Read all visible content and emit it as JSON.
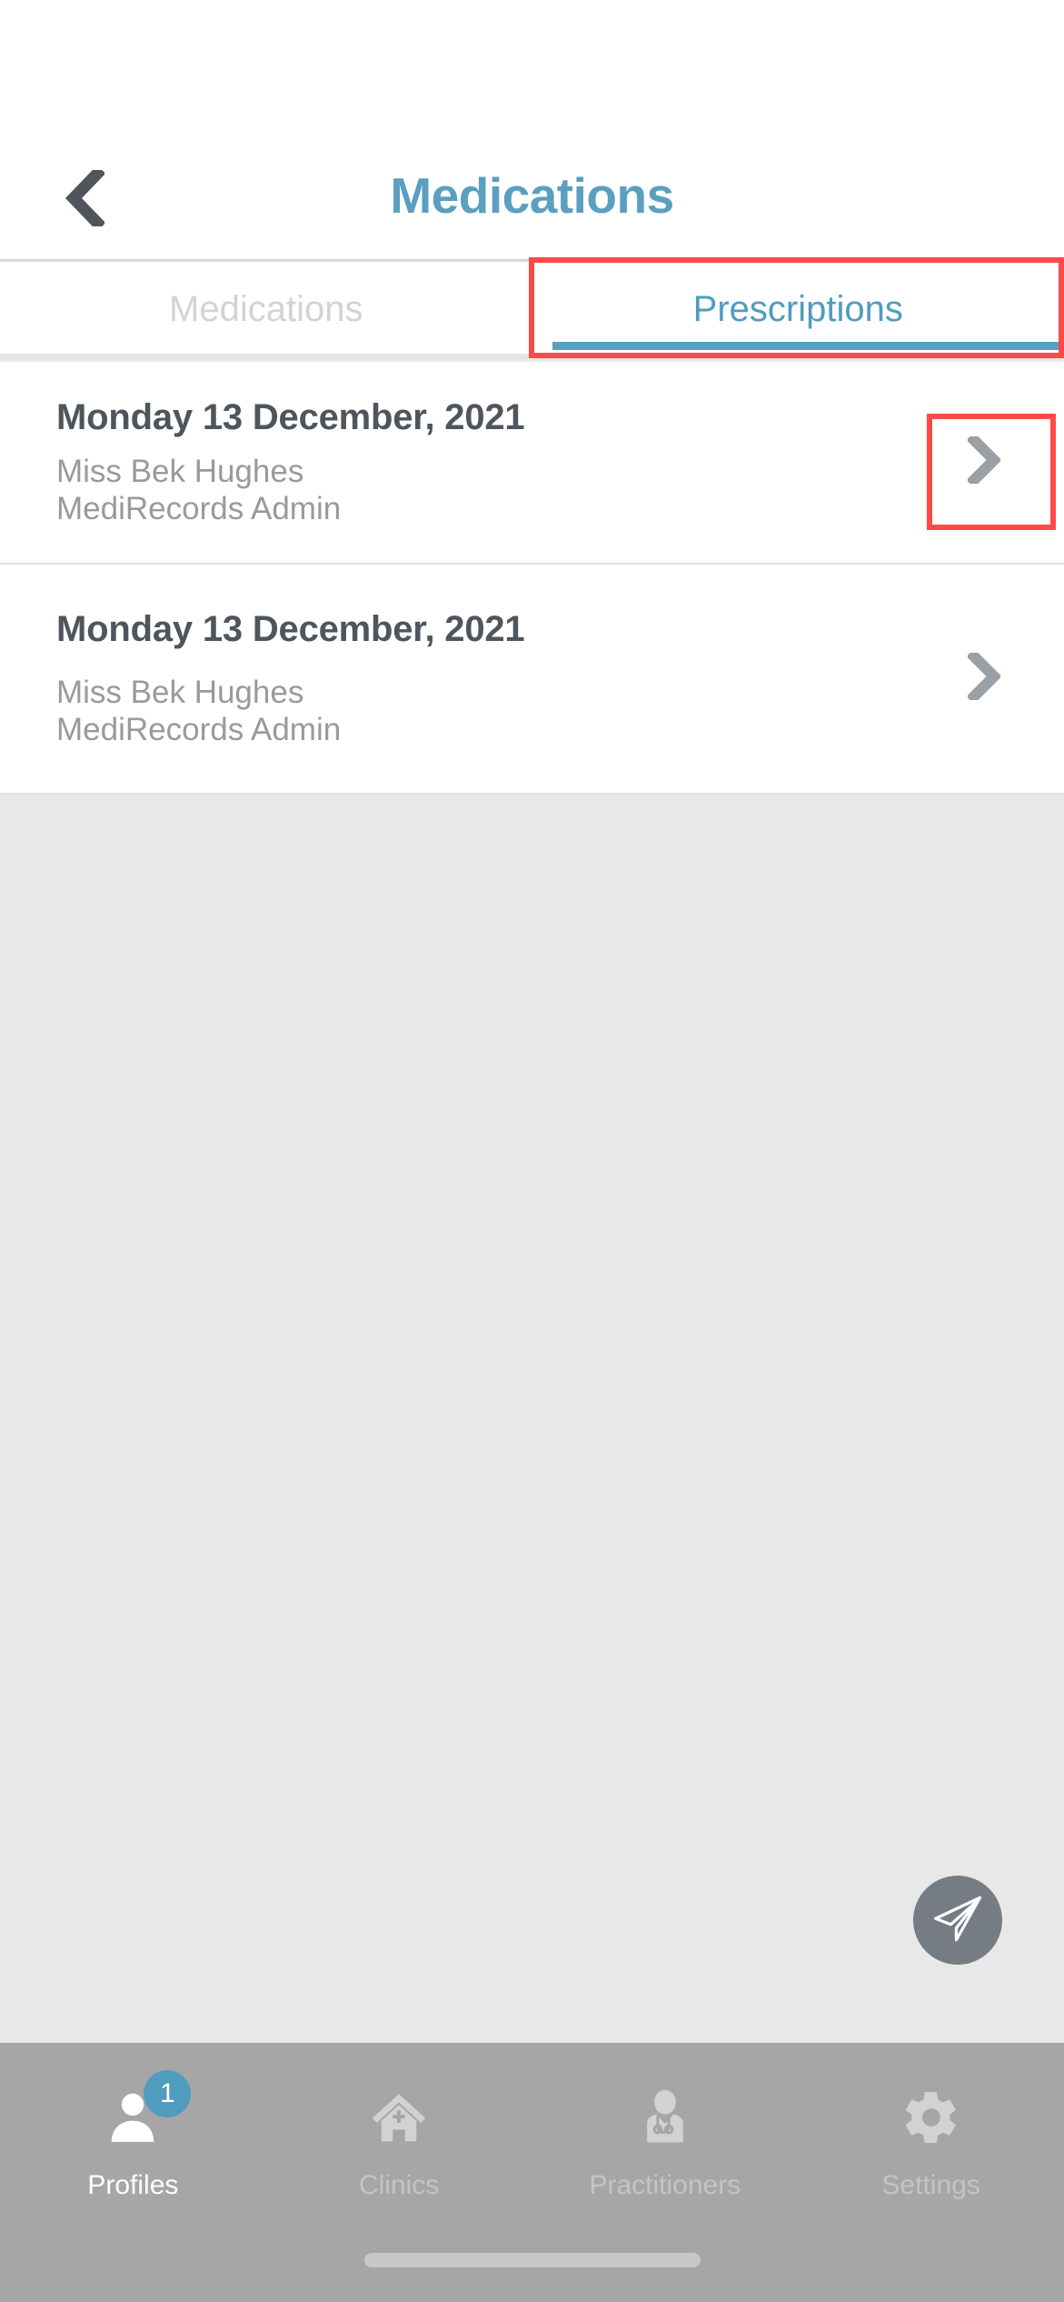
{
  "header": {
    "title": "Medications",
    "back_icon": "chevron-left-icon"
  },
  "tabs": [
    {
      "label": "Medications",
      "active": false
    },
    {
      "label": "Prescriptions",
      "active": true
    }
  ],
  "prescriptions": [
    {
      "date": "Monday 13 December, 2021",
      "patient": "Miss Bek Hughes",
      "source": "MediRecords Admin",
      "chevron_icon": "chevron-right-icon"
    },
    {
      "date": "Monday 13 December, 2021",
      "patient": "Miss Bek Hughes",
      "source": "MediRecords Admin",
      "chevron_icon": "chevron-right-icon"
    }
  ],
  "fab": {
    "icon": "send-paper-plane-icon"
  },
  "bottom_nav": [
    {
      "label": "Profiles",
      "icon": "person-icon",
      "active": true,
      "badge": "1"
    },
    {
      "label": "Clinics",
      "icon": "clinic-house-plus-icon",
      "active": false
    },
    {
      "label": "Practitioners",
      "icon": "doctor-stethoscope-icon",
      "active": false
    },
    {
      "label": "Settings",
      "icon": "gear-icon",
      "active": false
    }
  ],
  "colors": {
    "accent_blue": "#5b9fc0",
    "tab_active_blue": "#4f9cbf",
    "annotation_red": "#fb4b46",
    "bottom_nav_bg": "#a6a6a6",
    "page_bg": "#e8e8e8",
    "text_dark": "#4f555c",
    "text_muted": "#9a9a9a"
  }
}
